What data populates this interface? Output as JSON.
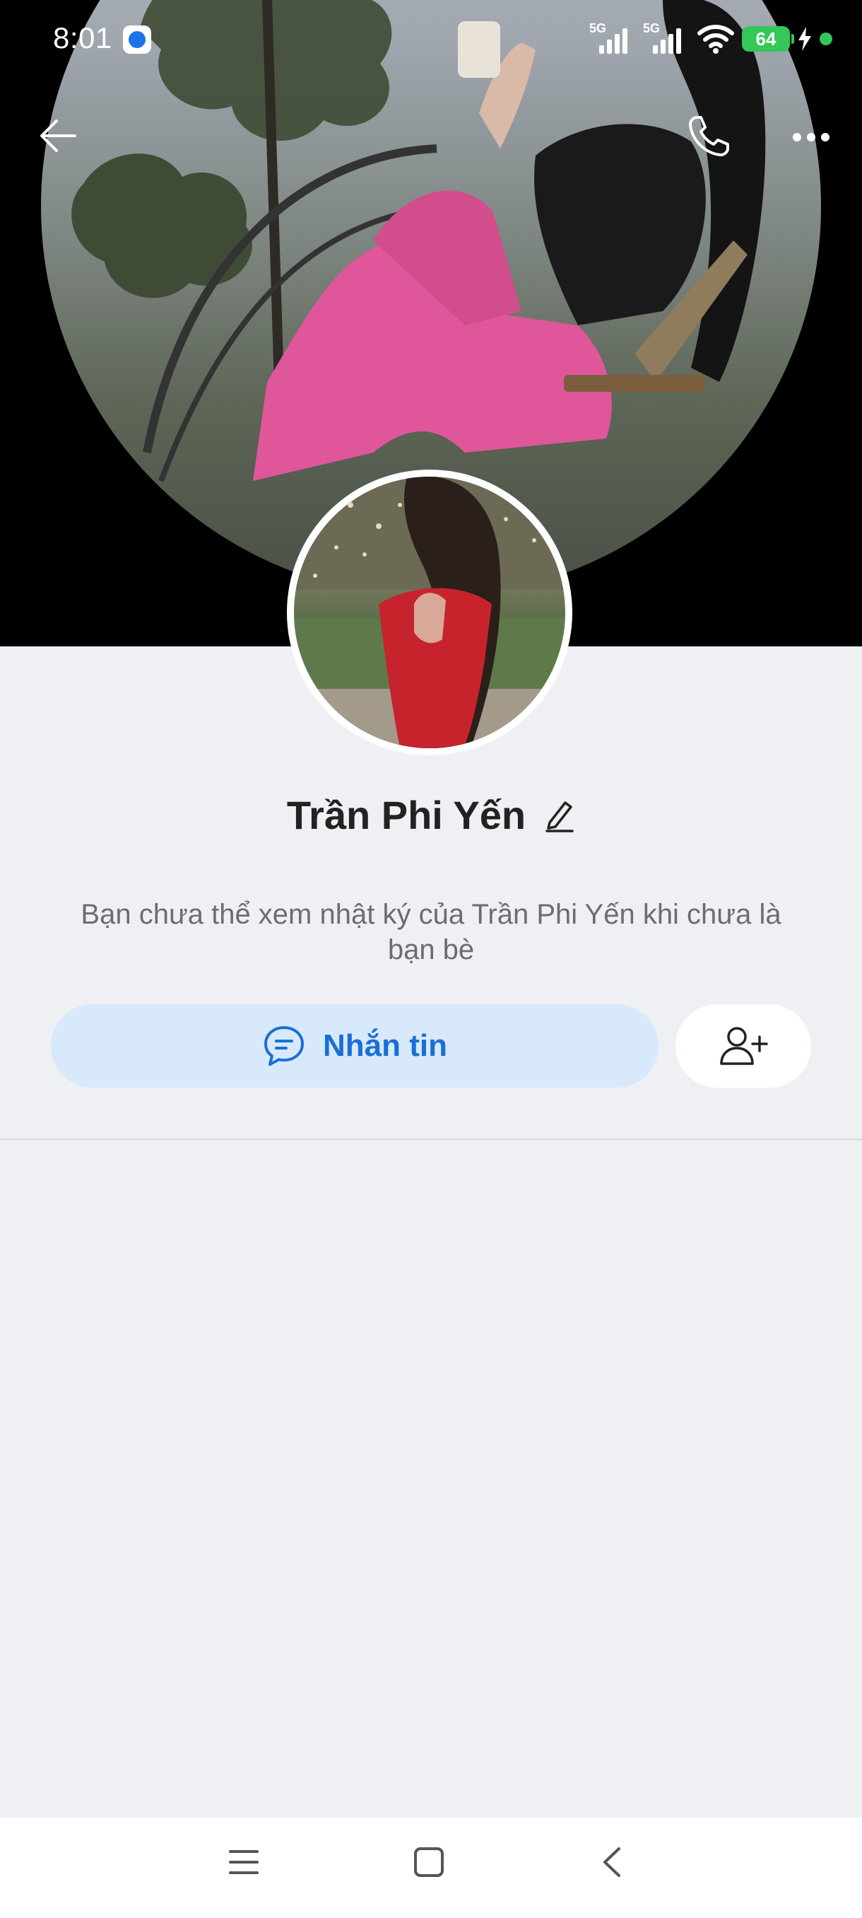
{
  "status_bar": {
    "time": "8:01",
    "network_1": "5G",
    "network_2": "5G",
    "battery": "64"
  },
  "top_bar": {
    "back_icon": "arrow-left-icon",
    "call_icon": "phone-icon",
    "more_icon": "more-horizontal-icon"
  },
  "profile": {
    "name": "Trần Phi Yến",
    "edit_icon": "pencil-icon",
    "notice": "Bạn chưa thể xem nhật ký của Trần Phi Yến khi chưa là bạn bè"
  },
  "actions": {
    "message_label": "Nhắn tin",
    "message_icon": "chat-bubble-icon",
    "add_friend_icon": "user-plus-icon"
  },
  "colors": {
    "accent": "#1a6fd6",
    "message_bg": "#d8e9fb",
    "page_bg": "#eff0f4",
    "battery": "#34c759"
  },
  "nav": {
    "menu_icon": "menu-icon",
    "home_icon": "square-icon",
    "back_icon": "chevron-left-icon"
  }
}
